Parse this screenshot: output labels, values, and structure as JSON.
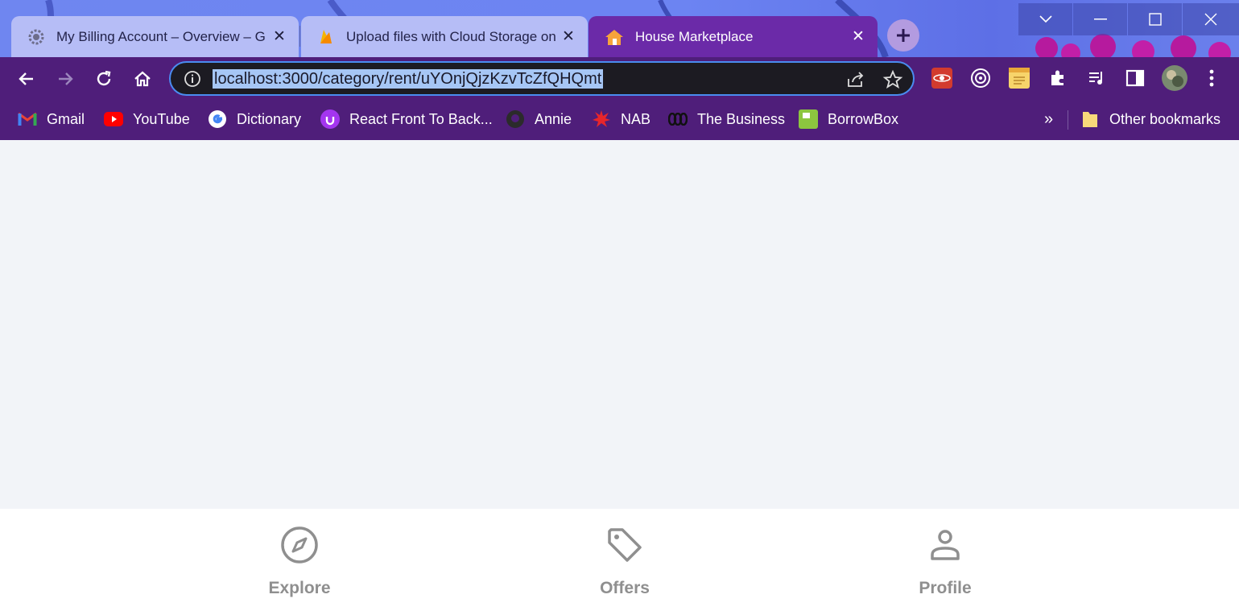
{
  "browser": {
    "tabs": [
      {
        "title": "My Billing Account – Overview – G",
        "icon": "gear-icon",
        "active": false
      },
      {
        "title": "Upload files with Cloud Storage on",
        "icon": "firebase-icon",
        "active": false
      },
      {
        "title": "House Marketplace",
        "icon": "house-icon",
        "active": true
      }
    ],
    "address": {
      "url": "localhost:3000/category/rent/uYOnjQjzKzvTcZfQHQmt"
    },
    "bookmarks": [
      {
        "label": "Gmail",
        "icon": "gmail-icon"
      },
      {
        "label": "YouTube",
        "icon": "youtube-icon"
      },
      {
        "label": "Dictionary",
        "icon": "google-icon"
      },
      {
        "label": "React Front To Back...",
        "icon": "udemy-icon"
      },
      {
        "label": "Annie",
        "icon": "github-icon"
      },
      {
        "label": "NAB",
        "icon": "nab-icon"
      },
      {
        "label": "The Business",
        "icon": "abc-icon"
      },
      {
        "label": "BorrowBox",
        "icon": "borrowbox-icon"
      }
    ],
    "more_bookmarks": "»",
    "other_bookmarks": "Other bookmarks"
  },
  "app": {
    "nav": [
      {
        "label": "Explore",
        "icon": "compass-icon"
      },
      {
        "label": "Offers",
        "icon": "tag-icon"
      },
      {
        "label": "Profile",
        "icon": "person-icon"
      }
    ]
  },
  "colors": {
    "toolbar": "#4f1e7a",
    "active_tab": "#6b2aa8",
    "page_bg": "#f2f4f8",
    "nav_icon": "#8f8f8f",
    "url_highlight": "#a6c6f5"
  }
}
